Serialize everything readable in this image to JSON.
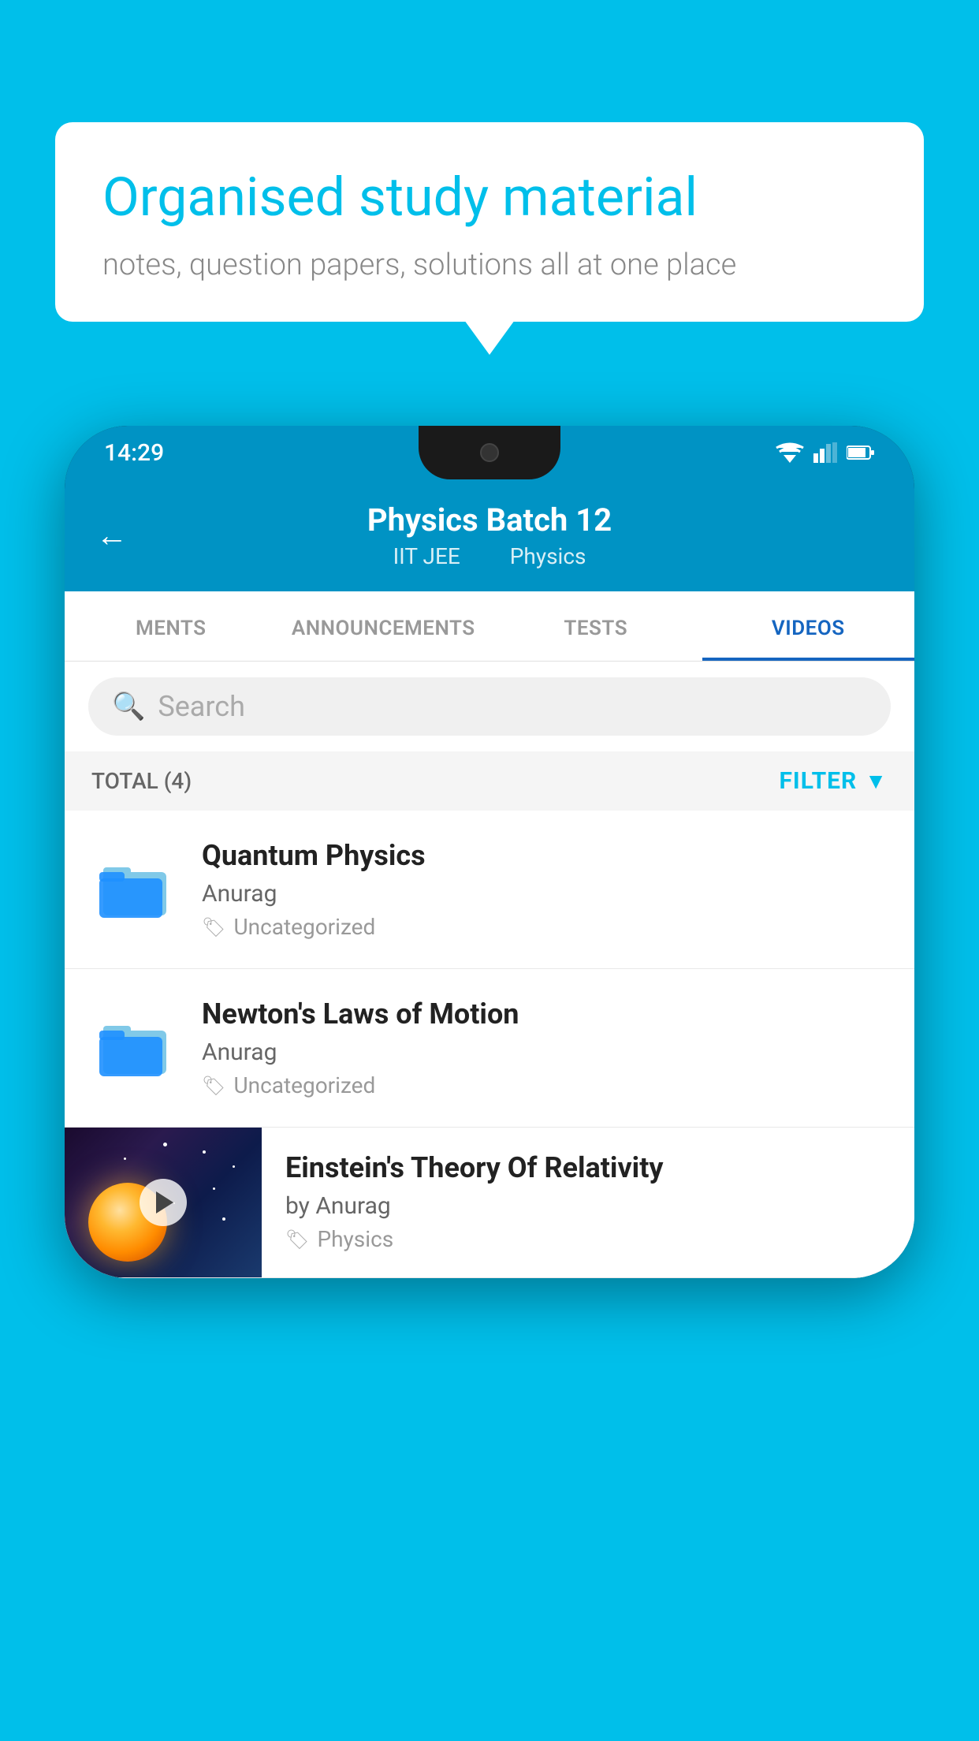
{
  "background_color": "#00BFEA",
  "speech_bubble": {
    "heading": "Organised study material",
    "subtext": "notes, question papers, solutions all at one place"
  },
  "phone": {
    "status_bar": {
      "time": "14:29"
    },
    "header": {
      "back_label": "←",
      "title": "Physics Batch 12",
      "subtitle_part1": "IIT JEE",
      "subtitle_part2": "Physics"
    },
    "tabs": [
      {
        "label": "MENTS",
        "active": false
      },
      {
        "label": "ANNOUNCEMENTS",
        "active": false
      },
      {
        "label": "TESTS",
        "active": false
      },
      {
        "label": "VIDEOS",
        "active": true
      }
    ],
    "search": {
      "placeholder": "Search"
    },
    "filter": {
      "total_label": "TOTAL (4)",
      "filter_label": "FILTER"
    },
    "videos": [
      {
        "id": "quantum-physics",
        "title": "Quantum Physics",
        "author": "Anurag",
        "tag": "Uncategorized",
        "type": "folder"
      },
      {
        "id": "newtons-laws",
        "title": "Newton's Laws of Motion",
        "author": "Anurag",
        "tag": "Uncategorized",
        "type": "folder"
      },
      {
        "id": "einstein-relativity",
        "title": "Einstein's Theory Of Relativity",
        "author": "by Anurag",
        "tag": "Physics",
        "type": "video"
      }
    ]
  }
}
